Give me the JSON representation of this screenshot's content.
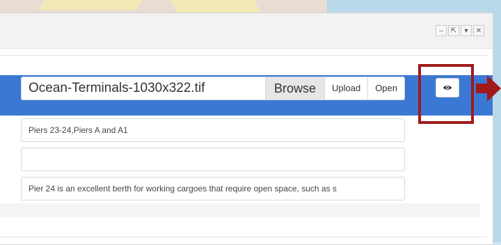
{
  "window": {
    "buttons": [
      {
        "name": "minimize",
        "glyph": "–"
      },
      {
        "name": "popout",
        "glyph": "⇱"
      },
      {
        "name": "dropdown",
        "glyph": "▾"
      },
      {
        "name": "close",
        "glyph": "✕"
      }
    ]
  },
  "file": {
    "filename": "Ocean-Terminals-1030x322.tif",
    "browse_label": "Browse",
    "upload_label": "Upload",
    "open_label": "Open"
  },
  "fields": {
    "title_value": "Piers 23-24,Piers A and A1",
    "empty_value": "",
    "description_value": "Pier 24 is an excellent berth for working cargoes that require open space, such as s"
  },
  "colors": {
    "highlight_row": "#3a78d4",
    "callout_red": "#a11a1a"
  },
  "icons": {
    "preview": "eye-icon",
    "callout": "arrow-right-icon"
  }
}
